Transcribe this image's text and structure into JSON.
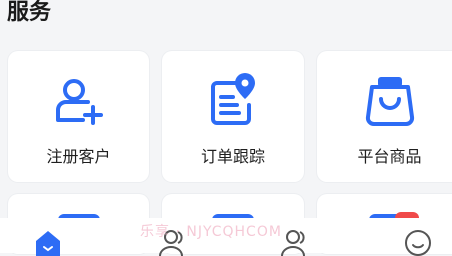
{
  "section": {
    "title": "服务"
  },
  "services": [
    {
      "label": "注册客户",
      "icon": "add-user-icon"
    },
    {
      "label": "订单跟踪",
      "icon": "order-tracking-icon"
    },
    {
      "label": "平台商品",
      "icon": "shopping-bag-icon"
    }
  ],
  "watermark": "乐享 · NJYCQHCOM",
  "tabbar": {
    "tabs": [
      {
        "icon": "home-icon",
        "active": true
      },
      {
        "icon": "customers-icon",
        "active": false
      },
      {
        "icon": "team-icon",
        "active": false
      },
      {
        "icon": "profile-icon",
        "active": false
      }
    ]
  },
  "colors": {
    "accent": "#2d6cf5",
    "badge": "#f04a4a",
    "background": "#f4f5f7"
  }
}
